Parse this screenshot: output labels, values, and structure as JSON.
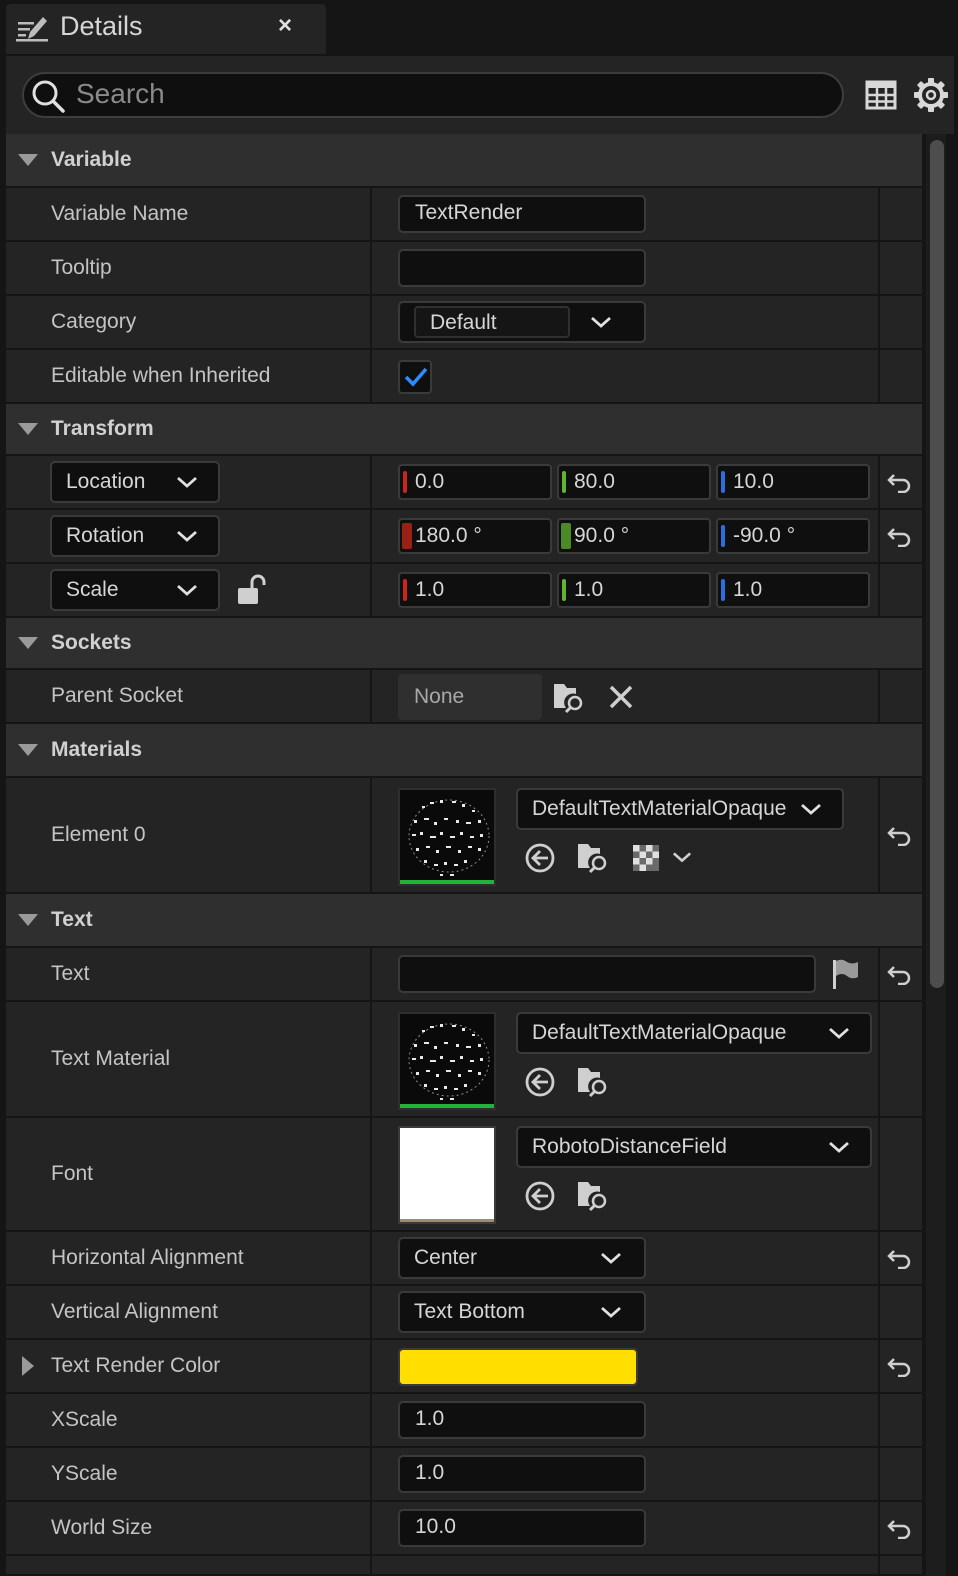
{
  "tab": {
    "title": "Details",
    "close": "×",
    "icon": "edit-details-icon"
  },
  "search": {
    "placeholder": "Search",
    "value": ""
  },
  "toolbar": {
    "table_icon": "property-matrix-icon",
    "settings_icon": "gear-icon"
  },
  "categories": {
    "variable": "Variable",
    "transform": "Transform",
    "sockets": "Sockets",
    "materials": "Materials",
    "text": "Text"
  },
  "variable": {
    "name_label": "Variable Name",
    "name_value": "TextRender",
    "tooltip_label": "Tooltip",
    "tooltip_value": "",
    "category_label": "Category",
    "category_value": "Default",
    "editable_label": "Editable when Inherited",
    "editable_checked": true
  },
  "transform": {
    "location": {
      "label": "Location",
      "x": "0.0",
      "y": "80.0",
      "z": "10.0"
    },
    "rotation": {
      "label": "Rotation",
      "x": "180.0 °",
      "y": "90.0 °",
      "z": "-90.0 °"
    },
    "scale": {
      "label": "Scale",
      "x": "1.0",
      "y": "1.0",
      "z": "1.0"
    },
    "axis_colors": {
      "x": "#c8271a",
      "y": "#62b330",
      "z": "#2c6de0"
    }
  },
  "sockets": {
    "parent_label": "Parent Socket",
    "parent_value": "None"
  },
  "materials": {
    "element0_label": "Element 0",
    "element0_value": "DefaultTextMaterialOpaque"
  },
  "text": {
    "text_label": "Text",
    "text_value": "",
    "material_label": "Text Material",
    "material_value": "DefaultTextMaterialOpaque",
    "font_label": "Font",
    "font_value": "RobotoDistanceField",
    "halign_label": "Horizontal Alignment",
    "halign_value": "Center",
    "valign_label": "Vertical Alignment",
    "valign_value": "Text Bottom",
    "color_label": "Text Render Color",
    "color_value": "#ffde00",
    "xscale_label": "XScale",
    "xscale_value": "1.0",
    "yscale_label": "YScale",
    "yscale_value": "1.0",
    "worldsize_label": "World Size",
    "worldsize_value": "10.0"
  }
}
